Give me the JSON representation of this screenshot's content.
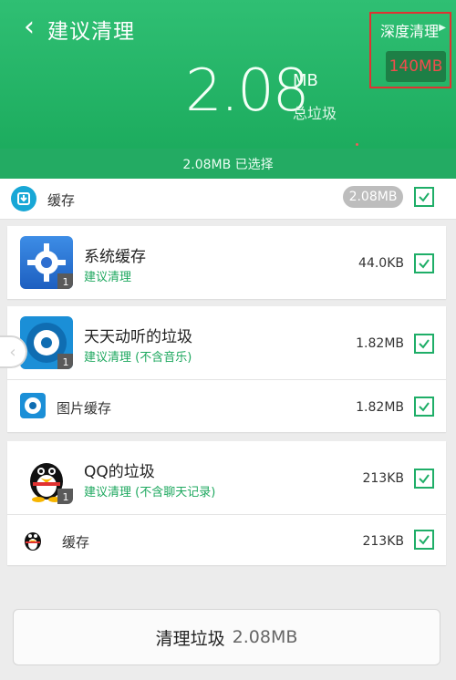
{
  "header": {
    "title": "建议清理",
    "back_icon": "chevron-left-icon",
    "deep_clean_label": "深度清理",
    "deep_clean_size": "140MB",
    "total_size": "2.08",
    "unit": "MB",
    "total_label": "总垃圾",
    "selected_text": "2.08MB 已选择"
  },
  "cache_section": {
    "label": "缓存",
    "size": "2.08MB",
    "checked": true
  },
  "items": [
    {
      "name": "系统缓存",
      "subtitle": "建议清理",
      "size": "44.0KB",
      "badge": "1",
      "icon": "gear-icon"
    },
    {
      "name": "天天动听的垃圾",
      "subtitle": "建议清理 (不含音乐)",
      "size": "1.82MB",
      "badge": "1",
      "icon": "music-app-icon"
    },
    {
      "name": "图片缓存",
      "subtitle": "",
      "size": "1.82MB",
      "icon": "music-app-small-icon"
    },
    {
      "name": "QQ的垃圾",
      "subtitle": "建议清理 (不含聊天记录)",
      "size": "213KB",
      "badge": "1",
      "icon": "qq-penguin-icon"
    },
    {
      "name": "缓存",
      "subtitle": "",
      "size": "213KB",
      "icon": "qq-penguin-small-icon"
    }
  ],
  "footer": {
    "button_label": "清理垃圾",
    "button_size": "2.08MB"
  },
  "colors": {
    "header_green": "#19a85a",
    "check_green": "#1fae68",
    "highlight_red": "#e03131"
  }
}
